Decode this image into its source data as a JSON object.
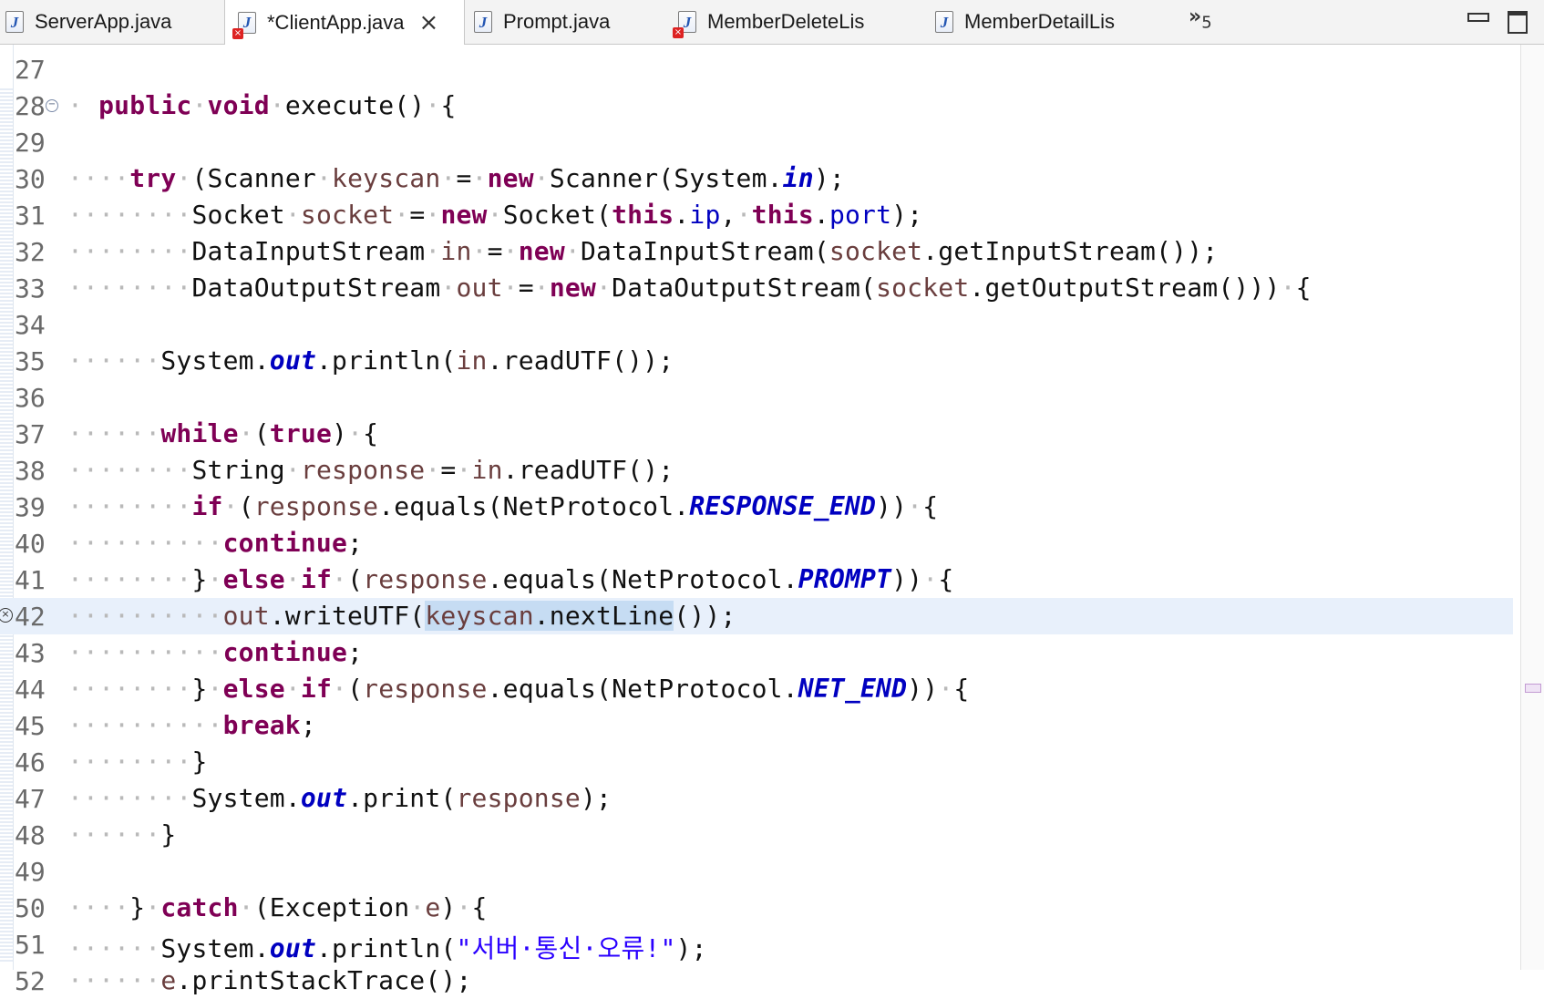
{
  "tabs": [
    {
      "label": "ServerApp.java",
      "active": false,
      "error": false
    },
    {
      "label": "*ClientApp.java",
      "active": true,
      "error": true
    },
    {
      "label": "Prompt.java",
      "active": false,
      "error": false
    },
    {
      "label": "MemberDeleteLis",
      "active": false,
      "error": true
    },
    {
      "label": "MemberDetailLis",
      "active": false,
      "error": false
    }
  ],
  "tab_overflow": {
    "glyph": "»",
    "count": "5"
  },
  "editor": {
    "current_line": 42,
    "lines": [
      {
        "n": "27",
        "tokens": []
      },
      {
        "n": "28",
        "tokens": [
          [
            "ws",
            "· "
          ],
          [
            "kw",
            "public"
          ],
          [
            "ws",
            "·"
          ],
          [
            "kw",
            "void"
          ],
          [
            "ws",
            "·"
          ],
          [
            "t",
            "execute()"
          ],
          [
            "ws",
            "·"
          ],
          [
            "t",
            "{"
          ]
        ]
      },
      {
        "n": "29",
        "tokens": []
      },
      {
        "n": "30",
        "tokens": [
          [
            "ws",
            "····"
          ],
          [
            "kw",
            "try"
          ],
          [
            "ws",
            "·"
          ],
          [
            "t",
            "(Scanner"
          ],
          [
            "ws",
            "·"
          ],
          [
            "var",
            "keyscan"
          ],
          [
            "ws",
            "·"
          ],
          [
            "t",
            "="
          ],
          [
            "ws",
            "·"
          ],
          [
            "kw",
            "new"
          ],
          [
            "ws",
            "·"
          ],
          [
            "t",
            "Scanner(System."
          ],
          [
            "sfld",
            "in"
          ],
          [
            "t",
            ");"
          ]
        ]
      },
      {
        "n": "31",
        "tokens": [
          [
            "ws",
            "········"
          ],
          [
            "t",
            "Socket"
          ],
          [
            "ws",
            "·"
          ],
          [
            "var",
            "socket"
          ],
          [
            "ws",
            "·"
          ],
          [
            "t",
            "="
          ],
          [
            "ws",
            "·"
          ],
          [
            "kw",
            "new"
          ],
          [
            "ws",
            "·"
          ],
          [
            "t",
            "Socket("
          ],
          [
            "kw",
            "this"
          ],
          [
            "t",
            "."
          ],
          [
            "fld",
            "ip"
          ],
          [
            "t",
            ","
          ],
          [
            "ws",
            "·"
          ],
          [
            "kw",
            "this"
          ],
          [
            "t",
            "."
          ],
          [
            "fld",
            "port"
          ],
          [
            "t",
            ");"
          ]
        ]
      },
      {
        "n": "32",
        "tokens": [
          [
            "ws",
            "········"
          ],
          [
            "t",
            "DataInputStream"
          ],
          [
            "ws",
            "·"
          ],
          [
            "var",
            "in"
          ],
          [
            "ws",
            "·"
          ],
          [
            "t",
            "="
          ],
          [
            "ws",
            "·"
          ],
          [
            "kw",
            "new"
          ],
          [
            "ws",
            "·"
          ],
          [
            "t",
            "DataInputStream("
          ],
          [
            "var",
            "socket"
          ],
          [
            "t",
            ".getInputStream());"
          ]
        ]
      },
      {
        "n": "33",
        "tokens": [
          [
            "ws",
            "········"
          ],
          [
            "t",
            "DataOutputStream"
          ],
          [
            "ws",
            "·"
          ],
          [
            "var",
            "out"
          ],
          [
            "ws",
            "·"
          ],
          [
            "t",
            "="
          ],
          [
            "ws",
            "·"
          ],
          [
            "kw",
            "new"
          ],
          [
            "ws",
            "·"
          ],
          [
            "t",
            "DataOutputStream("
          ],
          [
            "var",
            "socket"
          ],
          [
            "t",
            ".getOutputStream()))"
          ],
          [
            "ws",
            "·"
          ],
          [
            "t",
            "{"
          ]
        ]
      },
      {
        "n": "34",
        "tokens": []
      },
      {
        "n": "35",
        "tokens": [
          [
            "ws",
            "······"
          ],
          [
            "t",
            "System."
          ],
          [
            "sfld",
            "out"
          ],
          [
            "t",
            ".println("
          ],
          [
            "var",
            "in"
          ],
          [
            "t",
            ".readUTF());"
          ]
        ]
      },
      {
        "n": "36",
        "tokens": []
      },
      {
        "n": "37",
        "tokens": [
          [
            "ws",
            "······"
          ],
          [
            "kw",
            "while"
          ],
          [
            "ws",
            "·"
          ],
          [
            "t",
            "("
          ],
          [
            "kw",
            "true"
          ],
          [
            "t",
            ")"
          ],
          [
            "ws",
            "·"
          ],
          [
            "t",
            "{"
          ]
        ]
      },
      {
        "n": "38",
        "tokens": [
          [
            "ws",
            "········"
          ],
          [
            "t",
            "String"
          ],
          [
            "ws",
            "·"
          ],
          [
            "var",
            "response"
          ],
          [
            "ws",
            "·"
          ],
          [
            "t",
            "="
          ],
          [
            "ws",
            "·"
          ],
          [
            "var",
            "in"
          ],
          [
            "t",
            ".readUTF();"
          ]
        ]
      },
      {
        "n": "39",
        "tokens": [
          [
            "ws",
            "········"
          ],
          [
            "kw",
            "if"
          ],
          [
            "ws",
            "·"
          ],
          [
            "t",
            "("
          ],
          [
            "var",
            "response"
          ],
          [
            "t",
            ".equals(NetProtocol."
          ],
          [
            "sfld",
            "RESPONSE_END"
          ],
          [
            "t",
            "))"
          ],
          [
            "ws",
            "·"
          ],
          [
            "t",
            "{"
          ]
        ]
      },
      {
        "n": "40",
        "tokens": [
          [
            "ws",
            "··········"
          ],
          [
            "kw",
            "continue"
          ],
          [
            "t",
            ";"
          ]
        ]
      },
      {
        "n": "41",
        "tokens": [
          [
            "ws",
            "········"
          ],
          [
            "t",
            "}"
          ],
          [
            "ws",
            "·"
          ],
          [
            "kw",
            "else"
          ],
          [
            "ws",
            "·"
          ],
          [
            "kw",
            "if"
          ],
          [
            "ws",
            "·"
          ],
          [
            "t",
            "("
          ],
          [
            "var",
            "response"
          ],
          [
            "t",
            ".equals(NetProtocol."
          ],
          [
            "sfld",
            "PROMPT"
          ],
          [
            "t",
            "))"
          ],
          [
            "ws",
            "·"
          ],
          [
            "t",
            "{"
          ]
        ]
      },
      {
        "n": "42",
        "tokens": [
          [
            "ws",
            "··········"
          ],
          [
            "var",
            "out"
          ],
          [
            "t",
            ".writeUTF("
          ],
          [
            "selvar",
            "keyscan"
          ],
          [
            "selt",
            ".nextLine"
          ],
          [
            "t",
            "());"
          ]
        ]
      },
      {
        "n": "43",
        "tokens": [
          [
            "ws",
            "··········"
          ],
          [
            "kw",
            "continue"
          ],
          [
            "t",
            ";"
          ]
        ]
      },
      {
        "n": "44",
        "tokens": [
          [
            "ws",
            "········"
          ],
          [
            "t",
            "}"
          ],
          [
            "ws",
            "·"
          ],
          [
            "kw",
            "else"
          ],
          [
            "ws",
            "·"
          ],
          [
            "kw",
            "if"
          ],
          [
            "ws",
            "·"
          ],
          [
            "t",
            "("
          ],
          [
            "var",
            "response"
          ],
          [
            "t",
            ".equals(NetProtocol."
          ],
          [
            "sfld",
            "NET_END"
          ],
          [
            "t",
            "))"
          ],
          [
            "ws",
            "·"
          ],
          [
            "t",
            "{"
          ]
        ]
      },
      {
        "n": "45",
        "tokens": [
          [
            "ws",
            "··········"
          ],
          [
            "kw",
            "break"
          ],
          [
            "t",
            ";"
          ]
        ]
      },
      {
        "n": "46",
        "tokens": [
          [
            "ws",
            "········"
          ],
          [
            "t",
            "}"
          ]
        ]
      },
      {
        "n": "47",
        "tokens": [
          [
            "ws",
            "········"
          ],
          [
            "t",
            "System."
          ],
          [
            "sfld",
            "out"
          ],
          [
            "t",
            ".print("
          ],
          [
            "var",
            "response"
          ],
          [
            "t",
            ");"
          ]
        ]
      },
      {
        "n": "48",
        "tokens": [
          [
            "ws",
            "······"
          ],
          [
            "t",
            "}"
          ]
        ]
      },
      {
        "n": "49",
        "tokens": []
      },
      {
        "n": "50",
        "tokens": [
          [
            "ws",
            "····"
          ],
          [
            "t",
            "}"
          ],
          [
            "ws",
            "·"
          ],
          [
            "kw",
            "catch"
          ],
          [
            "ws",
            "·"
          ],
          [
            "t",
            "(Exception"
          ],
          [
            "ws",
            "·"
          ],
          [
            "var",
            "e"
          ],
          [
            "t",
            ")"
          ],
          [
            "ws",
            "·"
          ],
          [
            "t",
            "{"
          ]
        ]
      },
      {
        "n": "51",
        "tokens": [
          [
            "ws",
            "······"
          ],
          [
            "t",
            "System."
          ],
          [
            "sfld",
            "out"
          ],
          [
            "t",
            ".println("
          ],
          [
            "str",
            "\"서버·통신·오류!\""
          ],
          [
            "t",
            ");"
          ]
        ]
      },
      {
        "n": "52",
        "tokens": [
          [
            "ws",
            "······"
          ],
          [
            "var",
            "e"
          ],
          [
            "t",
            ".printStackTrace();"
          ]
        ]
      }
    ]
  }
}
